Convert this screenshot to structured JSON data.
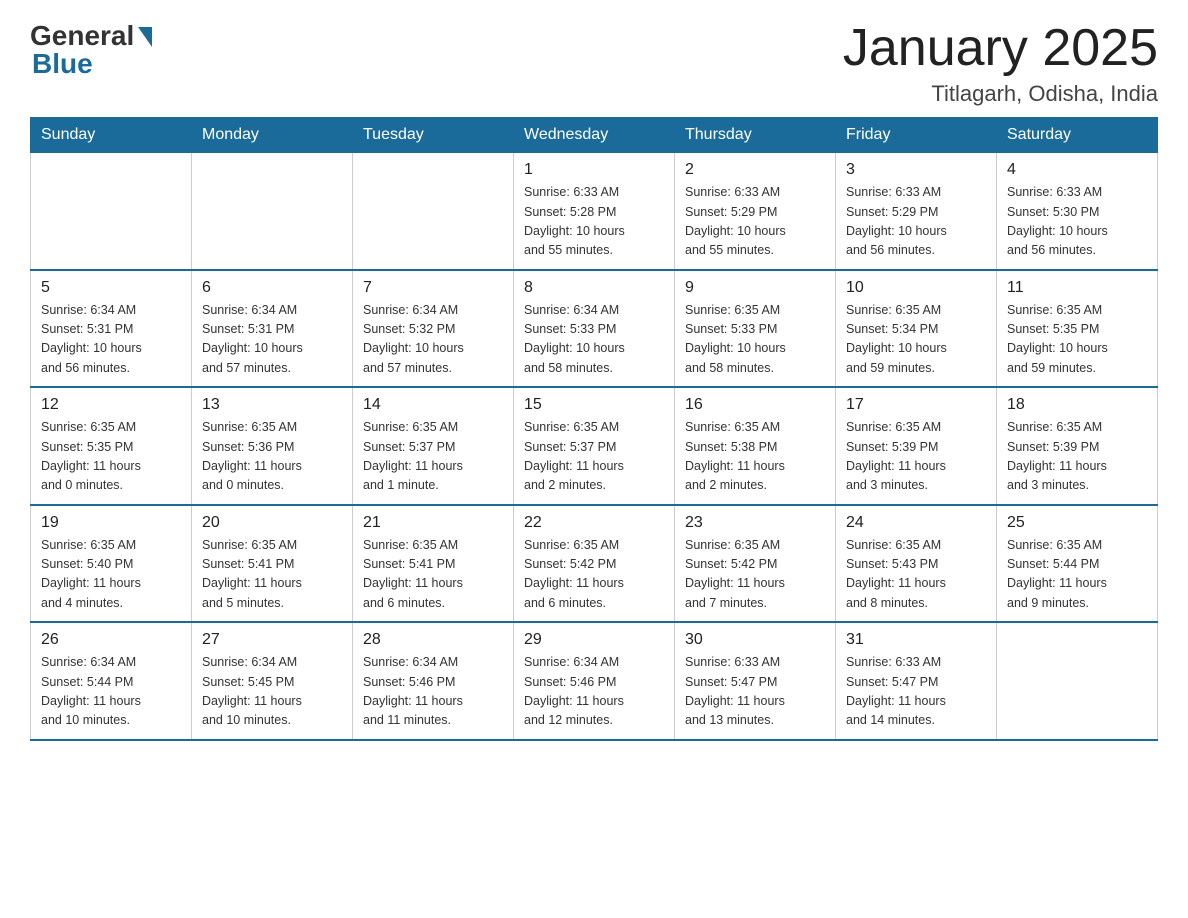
{
  "header": {
    "logo_general": "General",
    "logo_blue": "Blue",
    "title": "January 2025",
    "subtitle": "Titlagarh, Odisha, India"
  },
  "columns": [
    "Sunday",
    "Monday",
    "Tuesday",
    "Wednesday",
    "Thursday",
    "Friday",
    "Saturday"
  ],
  "weeks": [
    [
      {
        "day": "",
        "info": ""
      },
      {
        "day": "",
        "info": ""
      },
      {
        "day": "",
        "info": ""
      },
      {
        "day": "1",
        "info": "Sunrise: 6:33 AM\nSunset: 5:28 PM\nDaylight: 10 hours\nand 55 minutes."
      },
      {
        "day": "2",
        "info": "Sunrise: 6:33 AM\nSunset: 5:29 PM\nDaylight: 10 hours\nand 55 minutes."
      },
      {
        "day": "3",
        "info": "Sunrise: 6:33 AM\nSunset: 5:29 PM\nDaylight: 10 hours\nand 56 minutes."
      },
      {
        "day": "4",
        "info": "Sunrise: 6:33 AM\nSunset: 5:30 PM\nDaylight: 10 hours\nand 56 minutes."
      }
    ],
    [
      {
        "day": "5",
        "info": "Sunrise: 6:34 AM\nSunset: 5:31 PM\nDaylight: 10 hours\nand 56 minutes."
      },
      {
        "day": "6",
        "info": "Sunrise: 6:34 AM\nSunset: 5:31 PM\nDaylight: 10 hours\nand 57 minutes."
      },
      {
        "day": "7",
        "info": "Sunrise: 6:34 AM\nSunset: 5:32 PM\nDaylight: 10 hours\nand 57 minutes."
      },
      {
        "day": "8",
        "info": "Sunrise: 6:34 AM\nSunset: 5:33 PM\nDaylight: 10 hours\nand 58 minutes."
      },
      {
        "day": "9",
        "info": "Sunrise: 6:35 AM\nSunset: 5:33 PM\nDaylight: 10 hours\nand 58 minutes."
      },
      {
        "day": "10",
        "info": "Sunrise: 6:35 AM\nSunset: 5:34 PM\nDaylight: 10 hours\nand 59 minutes."
      },
      {
        "day": "11",
        "info": "Sunrise: 6:35 AM\nSunset: 5:35 PM\nDaylight: 10 hours\nand 59 minutes."
      }
    ],
    [
      {
        "day": "12",
        "info": "Sunrise: 6:35 AM\nSunset: 5:35 PM\nDaylight: 11 hours\nand 0 minutes."
      },
      {
        "day": "13",
        "info": "Sunrise: 6:35 AM\nSunset: 5:36 PM\nDaylight: 11 hours\nand 0 minutes."
      },
      {
        "day": "14",
        "info": "Sunrise: 6:35 AM\nSunset: 5:37 PM\nDaylight: 11 hours\nand 1 minute."
      },
      {
        "day": "15",
        "info": "Sunrise: 6:35 AM\nSunset: 5:37 PM\nDaylight: 11 hours\nand 2 minutes."
      },
      {
        "day": "16",
        "info": "Sunrise: 6:35 AM\nSunset: 5:38 PM\nDaylight: 11 hours\nand 2 minutes."
      },
      {
        "day": "17",
        "info": "Sunrise: 6:35 AM\nSunset: 5:39 PM\nDaylight: 11 hours\nand 3 minutes."
      },
      {
        "day": "18",
        "info": "Sunrise: 6:35 AM\nSunset: 5:39 PM\nDaylight: 11 hours\nand 3 minutes."
      }
    ],
    [
      {
        "day": "19",
        "info": "Sunrise: 6:35 AM\nSunset: 5:40 PM\nDaylight: 11 hours\nand 4 minutes."
      },
      {
        "day": "20",
        "info": "Sunrise: 6:35 AM\nSunset: 5:41 PM\nDaylight: 11 hours\nand 5 minutes."
      },
      {
        "day": "21",
        "info": "Sunrise: 6:35 AM\nSunset: 5:41 PM\nDaylight: 11 hours\nand 6 minutes."
      },
      {
        "day": "22",
        "info": "Sunrise: 6:35 AM\nSunset: 5:42 PM\nDaylight: 11 hours\nand 6 minutes."
      },
      {
        "day": "23",
        "info": "Sunrise: 6:35 AM\nSunset: 5:42 PM\nDaylight: 11 hours\nand 7 minutes."
      },
      {
        "day": "24",
        "info": "Sunrise: 6:35 AM\nSunset: 5:43 PM\nDaylight: 11 hours\nand 8 minutes."
      },
      {
        "day": "25",
        "info": "Sunrise: 6:35 AM\nSunset: 5:44 PM\nDaylight: 11 hours\nand 9 minutes."
      }
    ],
    [
      {
        "day": "26",
        "info": "Sunrise: 6:34 AM\nSunset: 5:44 PM\nDaylight: 11 hours\nand 10 minutes."
      },
      {
        "day": "27",
        "info": "Sunrise: 6:34 AM\nSunset: 5:45 PM\nDaylight: 11 hours\nand 10 minutes."
      },
      {
        "day": "28",
        "info": "Sunrise: 6:34 AM\nSunset: 5:46 PM\nDaylight: 11 hours\nand 11 minutes."
      },
      {
        "day": "29",
        "info": "Sunrise: 6:34 AM\nSunset: 5:46 PM\nDaylight: 11 hours\nand 12 minutes."
      },
      {
        "day": "30",
        "info": "Sunrise: 6:33 AM\nSunset: 5:47 PM\nDaylight: 11 hours\nand 13 minutes."
      },
      {
        "day": "31",
        "info": "Sunrise: 6:33 AM\nSunset: 5:47 PM\nDaylight: 11 hours\nand 14 minutes."
      },
      {
        "day": "",
        "info": ""
      }
    ]
  ]
}
